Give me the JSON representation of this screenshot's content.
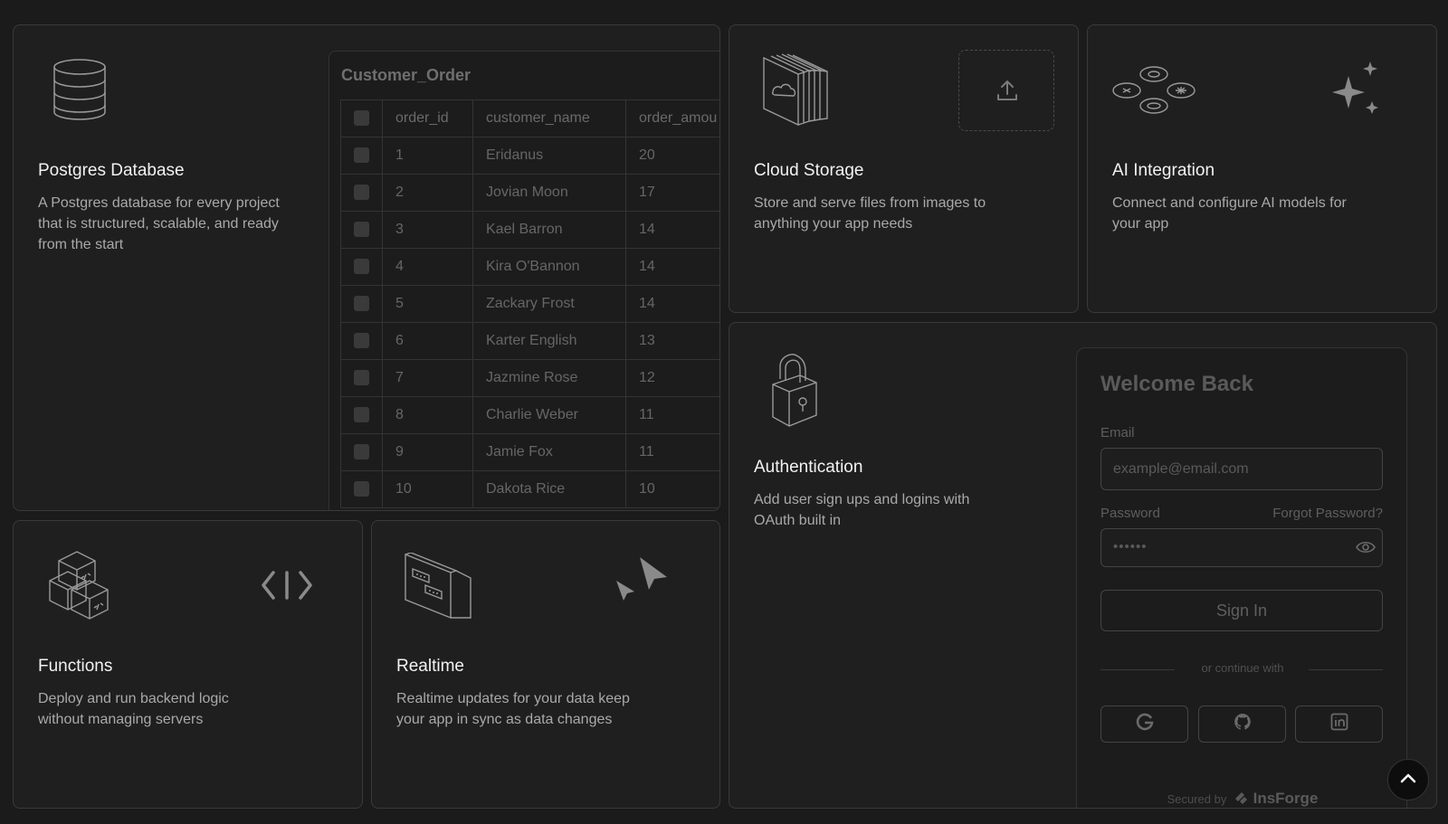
{
  "postgres": {
    "title": "Postgres Database",
    "description": "A Postgres database for every project that is structured, scalable, and ready from the start",
    "table_name": "Customer_Order",
    "columns": [
      "order_id",
      "customer_name",
      "order_amou"
    ],
    "rows": [
      [
        "1",
        "Eridanus",
        "20"
      ],
      [
        "2",
        "Jovian Moon",
        "17"
      ],
      [
        "3",
        "Kael Barron",
        "14"
      ],
      [
        "4",
        "Kira O'Bannon",
        "14"
      ],
      [
        "5",
        "Zackary Frost",
        "14"
      ],
      [
        "6",
        "Karter English",
        "13"
      ],
      [
        "7",
        "Jazmine Rose",
        "12"
      ],
      [
        "8",
        "Charlie Weber",
        "11"
      ],
      [
        "9",
        "Jamie Fox",
        "11"
      ],
      [
        "10",
        "Dakota Rice",
        "10"
      ]
    ]
  },
  "cloud": {
    "title": "Cloud Storage",
    "description": "Store and serve files from images to anything your app needs"
  },
  "ai": {
    "title": "AI Integration",
    "description": "Connect and configure AI models for your app"
  },
  "auth": {
    "title": "Authentication",
    "description": "Add user sign ups and logins with OAuth built in",
    "login": {
      "title": "Welcome Back",
      "email_label": "Email",
      "email_placeholder": "example@email.com",
      "password_label": "Password",
      "forgot_label": "Forgot Password?",
      "password_mask": "••••••",
      "signin_label": "Sign In",
      "continue_label": "or continue with",
      "social": [
        "google-icon",
        "github-icon",
        "linkedin-icon"
      ],
      "secured_prefix": "Secured by",
      "secured_brand": "InsForge"
    }
  },
  "functions": {
    "title": "Functions",
    "description": "Deploy and run backend logic without managing servers"
  },
  "realtime": {
    "title": "Realtime",
    "description": "Realtime updates for your data keep your app in sync as data changes"
  },
  "colors": {
    "background": "#1b1b1b",
    "card": "#1f1f1f",
    "border": "#3a3a3a",
    "muted_text": "#a9a9a9"
  }
}
